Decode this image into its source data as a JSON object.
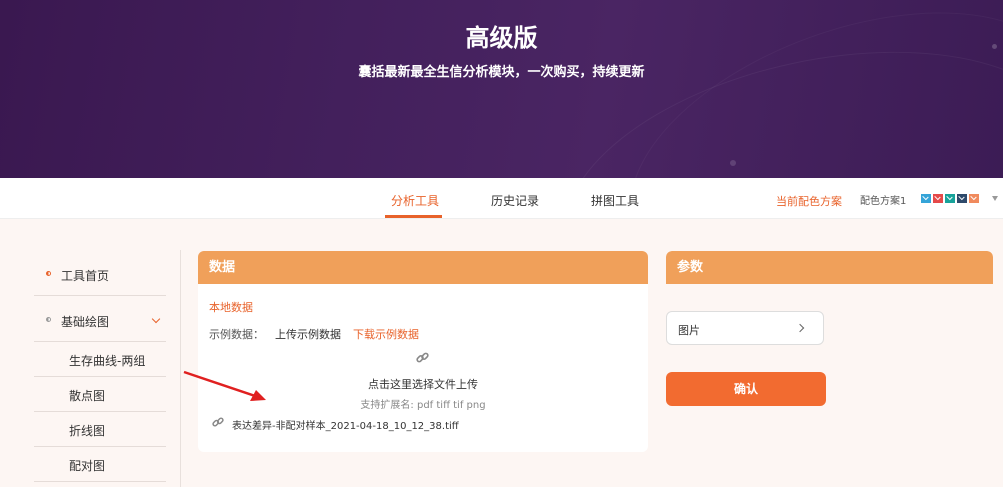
{
  "banner": {
    "title": "高级版",
    "subtitle": "囊括最新最全生信分析模块，一次购买，持续更新"
  },
  "tabs": [
    {
      "label": "分析工具",
      "active": true
    },
    {
      "label": "历史记录",
      "active": false
    },
    {
      "label": "拼图工具",
      "active": false
    }
  ],
  "color_scheme": {
    "label": "当前配色方案",
    "name": "配色方案1",
    "swatches": [
      "#35a4d8",
      "#e54a4a",
      "#17a39a",
      "#2e4a6b",
      "#f08a5d"
    ]
  },
  "sidebar": {
    "items": [
      {
        "label": "工具首页",
        "bullet_color": "#e8622a"
      },
      {
        "label": "基础绘图",
        "bullet_color": "#999999"
      },
      {
        "label": "生存曲线-两组"
      },
      {
        "label": "散点图"
      },
      {
        "label": "折线图"
      },
      {
        "label": "配对图"
      }
    ]
  },
  "data_panel": {
    "title": "数据",
    "local_data": "本地数据",
    "example_label": "示例数据：",
    "upload_example": "上传示例数据",
    "download_example": "下载示例数据",
    "upload_prompt": "点击这里选择文件上传",
    "supported": "支持扩展名: pdf tiff tif png",
    "file_name": "表达差异-非配对样本_2021-04-18_10_12_38.tiff"
  },
  "param_panel": {
    "title": "参数",
    "select_label": "图片",
    "confirm_label": "确认"
  },
  "colors": {
    "accent": "#e8622a",
    "header_orange": "#f0a05a",
    "button_orange": "#f26b30",
    "banner_purple": "#43205c"
  }
}
